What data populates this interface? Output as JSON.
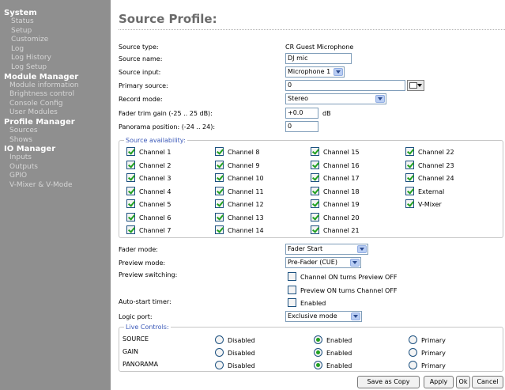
{
  "sidebar": [
    {
      "heading": "System",
      "items": [
        "Status",
        "Setup",
        "Customize",
        "Log",
        "Log History",
        "Log Setup"
      ]
    },
    {
      "heading": "Module Manager",
      "items": [
        "Module information",
        "Brightness control",
        "Console Config",
        "User Modules"
      ]
    },
    {
      "heading": "Profile Manager",
      "items": [
        "Sources",
        "Shows"
      ]
    },
    {
      "heading": "IO Manager",
      "items": [
        "Inputs",
        "Outputs",
        "GPIO",
        "V-Mixer & V-Mode"
      ]
    }
  ],
  "page_title": "Source Profile:",
  "form": {
    "source_type_label": "Source type:",
    "source_type_value": "CR Guest Microphone",
    "source_name_label": "Source name:",
    "source_name_value": "DJ mic",
    "source_input_label": "Source input:",
    "source_input_value": "Microphone 1",
    "primary_source_label": "Primary source:",
    "primary_source_value": "0",
    "record_mode_label": "Record mode:",
    "record_mode_value": "Stereo",
    "fader_trim_label": "Fader trim gain (-25 .. 25 dB):",
    "fader_trim_value": "+0.0",
    "fader_trim_unit": "dB",
    "panorama_label": "Panorama position: (-24 .. 24):",
    "panorama_value": "0"
  },
  "availability": {
    "title": "Source availability:",
    "columns": [
      [
        {
          "label": "Channel 1",
          "checked": true
        },
        {
          "label": "Channel 2",
          "checked": true
        },
        {
          "label": "Channel 3",
          "checked": true
        },
        {
          "label": "Channel 4",
          "checked": true
        },
        {
          "label": "Channel 5",
          "checked": true
        },
        {
          "label": "Channel 6",
          "checked": true
        },
        {
          "label": "Channel 7",
          "checked": true
        }
      ],
      [
        {
          "label": "Channel 8",
          "checked": true
        },
        {
          "label": "Channel 9",
          "checked": true
        },
        {
          "label": "Channel 10",
          "checked": true
        },
        {
          "label": "Channel 11",
          "checked": true
        },
        {
          "label": "Channel 12",
          "checked": true
        },
        {
          "label": "Channel 13",
          "checked": true
        },
        {
          "label": "Channel 14",
          "checked": true
        }
      ],
      [
        {
          "label": "Channel 15",
          "checked": true
        },
        {
          "label": "Channel 16",
          "checked": true
        },
        {
          "label": "Channel 17",
          "checked": true
        },
        {
          "label": "Channel 18",
          "checked": true
        },
        {
          "label": "Channel 19",
          "checked": true
        },
        {
          "label": "Channel 20",
          "checked": true
        },
        {
          "label": "Channel 21",
          "checked": true
        }
      ],
      [
        {
          "label": "Channel 22",
          "checked": true
        },
        {
          "label": "Channel 23",
          "checked": true
        },
        {
          "label": "Channel 24",
          "checked": true
        },
        {
          "label": "External",
          "checked": true
        },
        {
          "label": "V-Mixer",
          "checked": true
        }
      ]
    ]
  },
  "fader_mode_label": "Fader mode:",
  "fader_mode_value": "Fader Start",
  "preview_mode_label": "Preview mode:",
  "preview_mode_value": "Pre-Fader (CUE)",
  "preview_switching_label": "Preview switching:",
  "preview_switching": [
    {
      "label": "Channel ON turns Preview OFF",
      "checked": false
    },
    {
      "label": "Preview ON turns Channel OFF",
      "checked": false
    }
  ],
  "autostart_label": "Auto-start timer:",
  "autostart_option": {
    "label": "Enabled",
    "checked": false
  },
  "logic_port_label": "Logic port:",
  "logic_port_value": "Exclusive mode",
  "live_controls": {
    "title": "Live Controls:",
    "options": [
      "Disabled",
      "Enabled",
      "Primary"
    ],
    "rows": [
      {
        "name": "SOURCE",
        "selected": 1
      },
      {
        "name": "GAIN",
        "selected": 1
      },
      {
        "name": "PANORAMA",
        "selected": 1
      }
    ]
  },
  "buttons": {
    "save_as_copy": "Save as Copy",
    "apply": "Apply",
    "ok": "Ok",
    "cancel": "Cancel"
  },
  "colors": {
    "sidebar_bg": "#8f8f8f",
    "group_title": "#3a58b8",
    "check_mark": "#21a121"
  }
}
